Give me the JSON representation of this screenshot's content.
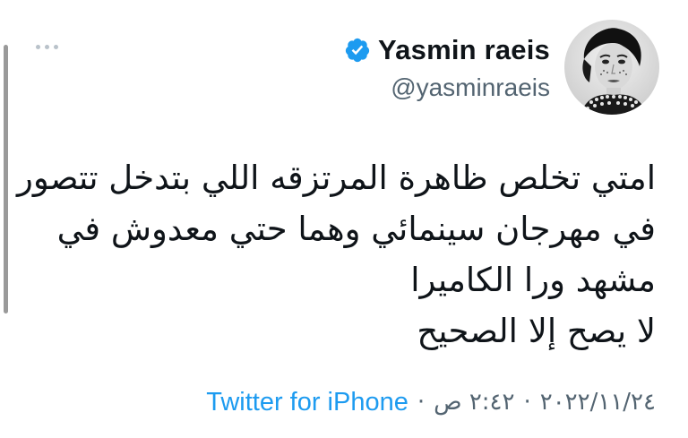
{
  "author": {
    "display_name": "Yasmin raeis",
    "handle": "@yasminraeis",
    "verified_icon": "verified-badge-icon",
    "verified_color": "#1d9bf0",
    "avatar_icon": "profile-avatar"
  },
  "tweet": {
    "text": "امتي تخلص ظاهرة المرتزقه اللي بتدخل تتصور\nفي مهرجان سينمائي وهما حتي معدوش في\nمشهد ورا الكاميرا\nلا يصح إلا الصحيح"
  },
  "meta": {
    "time": "٢:٤٢ ص",
    "date": "٢٠٢٢/١١/٢٤",
    "separator": "·",
    "source": "Twitter for iPhone",
    "source_color": "#1d9bf0"
  },
  "menu": {
    "more_icon": "more-options-icon"
  }
}
